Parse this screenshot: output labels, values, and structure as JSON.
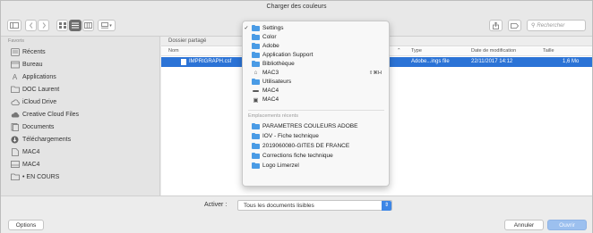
{
  "window": {
    "title": "Charger des couleurs"
  },
  "toolbar": {
    "search_placeholder": "Rechercher",
    "view_menu_label": "▾"
  },
  "sidebar": {
    "heading": "Favoris",
    "items": [
      {
        "label": "Récents",
        "icon": "recents-icon"
      },
      {
        "label": "Bureau",
        "icon": "desktop-icon"
      },
      {
        "label": "Applications",
        "icon": "applications-icon"
      },
      {
        "label": "DOC Laurent",
        "icon": "folder-icon"
      },
      {
        "label": "iCloud Drive",
        "icon": "cloud-icon"
      },
      {
        "label": "Creative Cloud Files",
        "icon": "creative-cloud-icon"
      },
      {
        "label": "Documents",
        "icon": "documents-icon"
      },
      {
        "label": "Téléchargements",
        "icon": "download-icon"
      },
      {
        "label": "MAC4",
        "icon": "document-icon"
      },
      {
        "label": "MAC4",
        "icon": "drive-icon"
      },
      {
        "label": "• EN COURS",
        "icon": "folder-icon"
      }
    ]
  },
  "content": {
    "breadcrumb": "Dossier partagé",
    "columns": {
      "name": "Nom",
      "type": "Type",
      "modified": "Date de modification",
      "size": "Taille"
    },
    "rows": [
      {
        "name": "IMPRIGRAPH.csf",
        "type": "Adobe...ings file",
        "modified": "22/11/2017 14:12",
        "size": "1,6 Mo"
      }
    ]
  },
  "location_menu": {
    "items": [
      {
        "label": "Settings",
        "checked": true,
        "icon": "folder-icon"
      },
      {
        "label": "Color",
        "icon": "folder-icon"
      },
      {
        "label": "Adobe",
        "icon": "folder-icon"
      },
      {
        "label": "Application Support",
        "icon": "folder-icon"
      },
      {
        "label": "Bibliothèque",
        "icon": "folder-icon"
      },
      {
        "label": "MAC3",
        "icon": "home-icon",
        "shortcut": "⇧⌘H"
      },
      {
        "label": "Utilisateurs",
        "icon": "folder-icon"
      },
      {
        "label": "MAC4",
        "icon": "drive-icon"
      },
      {
        "label": "MAC4",
        "icon": "computer-icon"
      }
    ],
    "recent_heading": "Emplacements récents",
    "recent": [
      {
        "label": "PARAMETRES COULEURS ADOBE"
      },
      {
        "label": "IOV - Fiche technique"
      },
      {
        "label": "2019060080-GITES DE FRANCE"
      },
      {
        "label": "Corrections fiche technique"
      },
      {
        "label": "Logo Limerzel"
      }
    ]
  },
  "bottom": {
    "activate_label": "Activer :",
    "activate_value": "Tous les documents lisibles",
    "options_label": "Options",
    "cancel_label": "Annuler",
    "open_label": "Ouvrir"
  },
  "colors": {
    "accent": "#2b73d6",
    "folder": "#4a9be5"
  }
}
